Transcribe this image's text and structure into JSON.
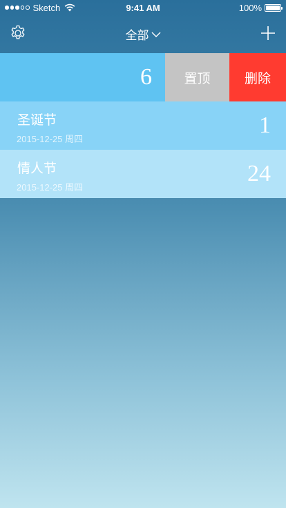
{
  "status_bar": {
    "carrier": "Sketch",
    "time": "9:41 AM",
    "battery": "100%",
    "signal_filled": 3,
    "signal_total": 5
  },
  "nav": {
    "title": "全部",
    "settings_icon": "gear-icon",
    "add_icon": "plus-icon",
    "dropdown_icon": "chevron-down-icon"
  },
  "swiped_item": {
    "count": "6",
    "pin_label": "置顶",
    "delete_label": "删除"
  },
  "events": [
    {
      "name": "圣诞节",
      "date": "2015-12-25 周四",
      "count": "1"
    },
    {
      "name": "情人节",
      "date": "2015-12-25 周四",
      "count": "24"
    }
  ],
  "colors": {
    "swiped_row": "#5fc3f2",
    "pin_button": "#c4c4c4",
    "delete_button": "#ff3b30",
    "row_1": "#88d3f7",
    "row_2": "#b2e3f9"
  }
}
